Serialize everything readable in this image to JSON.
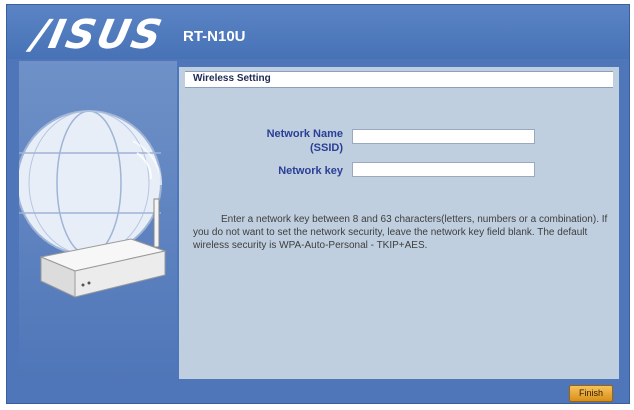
{
  "brand": {
    "logo_text": "/ISUS",
    "model": "RT-N10U"
  },
  "section": {
    "title": "Wireless Setting"
  },
  "form": {
    "ssid_label_line1": "Network Name",
    "ssid_label_line2": "(SSID)",
    "ssid_value": "",
    "key_label": "Network key",
    "key_value": ""
  },
  "note": "Enter a network key between 8 and 63 characters(letters, numbers or a combination). If you do not want to set the network security, leave the network key field blank. The default wireless security is WPA-Auto-Personal - TKIP+AES.",
  "actions": {
    "finish_label": "Finish"
  },
  "colors": {
    "frame_blue": "#4f76b8",
    "content_bg": "#bfcfdf",
    "label_blue": "#2a3f95",
    "button_orange": "#e8a83a"
  }
}
